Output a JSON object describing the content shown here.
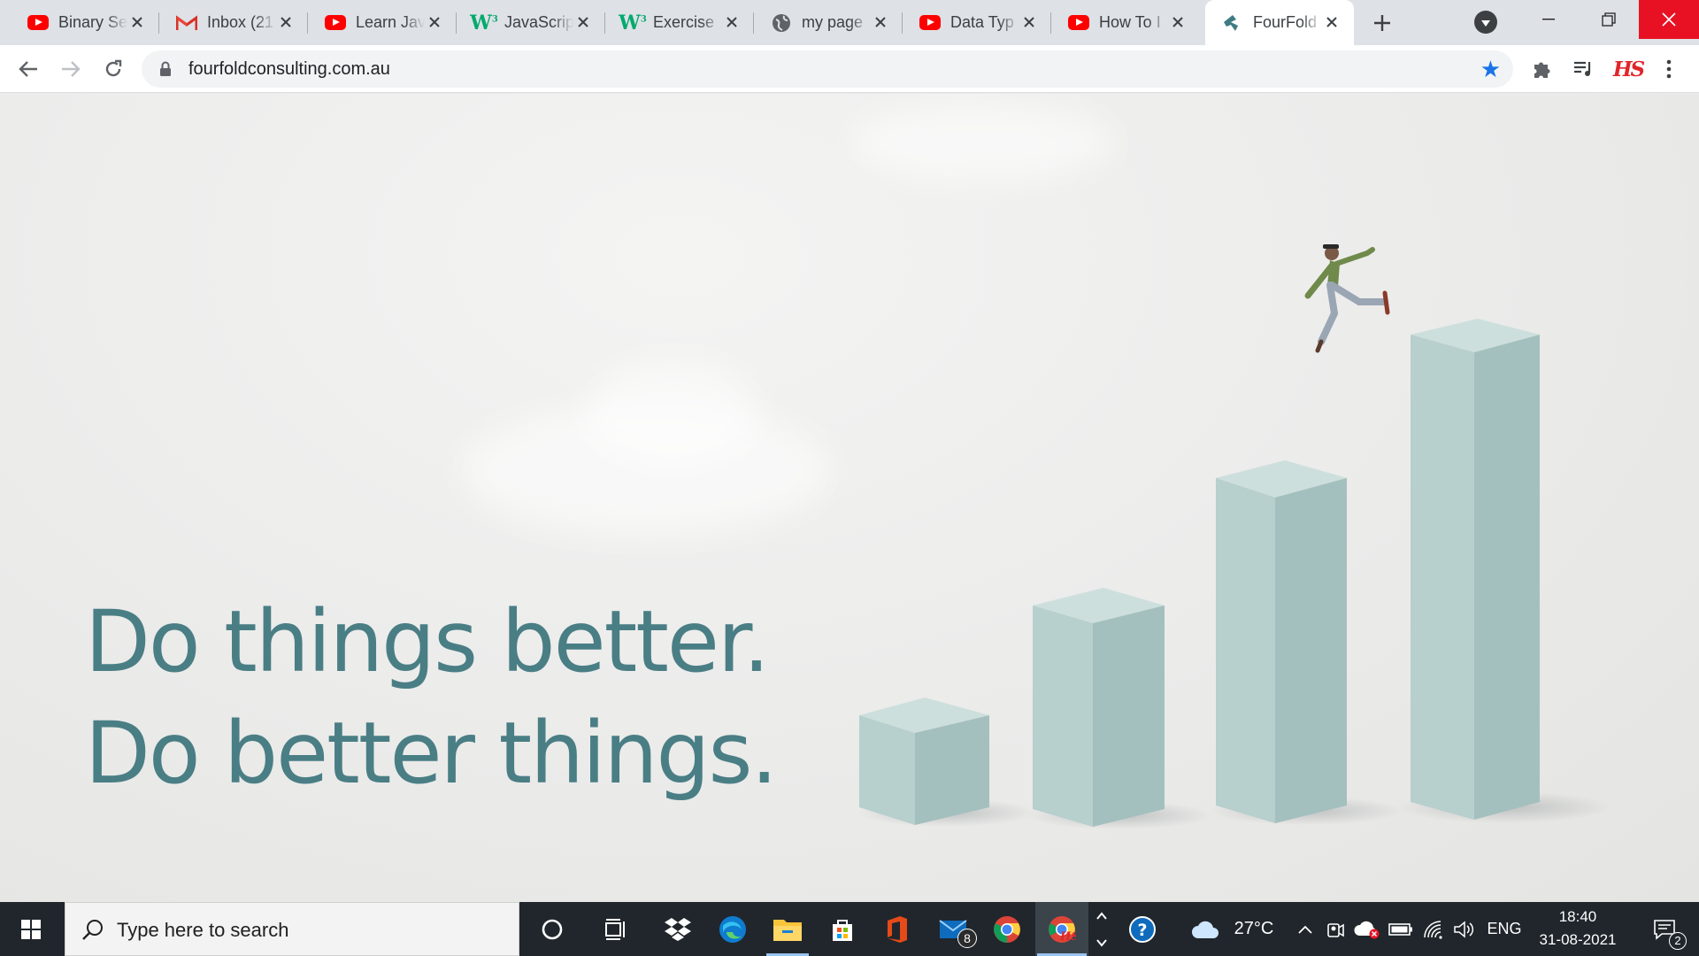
{
  "browser": {
    "tabs": [
      {
        "title": "Binary Se",
        "icon": "youtube-icon"
      },
      {
        "title": "Inbox (21",
        "icon": "gmail-icon"
      },
      {
        "title": "Learn Jav",
        "icon": "youtube-icon"
      },
      {
        "title": "JavaScrip",
        "icon": "w3schools-icon"
      },
      {
        "title": "Exercise",
        "icon": "w3schools-icon"
      },
      {
        "title": "my page",
        "icon": "globe-icon"
      },
      {
        "title": "Data Typ",
        "icon": "youtube-icon"
      },
      {
        "title": "How To I",
        "icon": "youtube-icon"
      },
      {
        "title": "FourFold",
        "icon": "fourfold-icon",
        "active": true
      }
    ],
    "url": "fourfoldconsulting.com.au",
    "extension_label": "HS"
  },
  "hero": {
    "line1": "Do things better.",
    "line2": "Do better things."
  },
  "taskbar": {
    "search_placeholder": "Type here to search",
    "mail_badge": "8",
    "weather": "27°C",
    "language": "ENG",
    "time": "18:40",
    "date": "31-08-2021",
    "notification_count": "2"
  },
  "colors": {
    "headline": "#4a7e85",
    "blocks": "#b9d1cf",
    "tab_strip": "#dee1e6",
    "taskbar": "#20262c",
    "close_button": "#e81123"
  }
}
